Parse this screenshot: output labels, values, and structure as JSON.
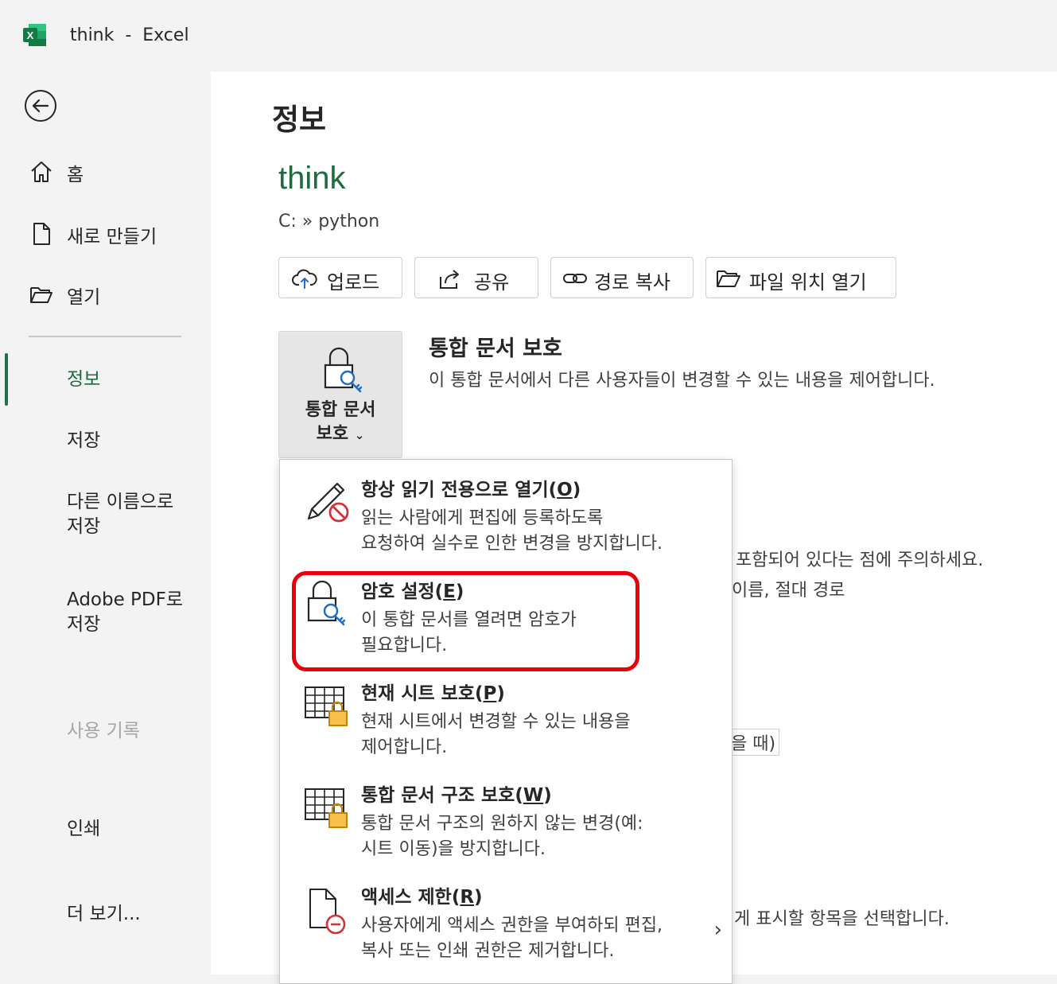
{
  "window": {
    "title": "think  -  Excel"
  },
  "sidebar": {
    "items": [
      {
        "label": "홈",
        "icon": "home-icon"
      },
      {
        "label": "새로 만들기",
        "icon": "new-file-icon"
      },
      {
        "label": "열기",
        "icon": "open-folder-icon"
      }
    ],
    "info": "정보",
    "save": "저장",
    "save_as": "다른 이름으로\n저장",
    "save_pdf": "Adobe PDF로\n저장",
    "history": "사용 기록",
    "print": "인쇄",
    "more": "더 보기..."
  },
  "main": {
    "page_title": "정보",
    "doc_name": "think",
    "doc_path": "C: » python",
    "actions": [
      {
        "label": "업로드",
        "icon": "upload-cloud-icon"
      },
      {
        "label": "공유",
        "icon": "share-icon"
      },
      {
        "label": "경로 복사",
        "icon": "link-icon"
      },
      {
        "label": "파일 위치 열기",
        "icon": "folder-open-icon"
      }
    ],
    "protect": {
      "tile_label_line1": "통합 문서",
      "tile_label_line2": "보호",
      "title": "통합 문서 보호",
      "description": "이 통합 문서에서 다른 사용자들이 변경할 수 있는 내용을 제어합니다."
    },
    "background_fragments": [
      "포함되어 있다는 점에 주의하세요.",
      "이름, 절대 경로",
      "을 때)",
      "게 표시할 항목을 선택합니다."
    ]
  },
  "protect_menu": {
    "items": [
      {
        "title": "항상 읽기 전용으로 열기",
        "key": "O",
        "desc": "읽는 사람에게 편집에 등록하도록\n요청하여 실수로 인한 변경을 방지합니다.",
        "icon": "pencil-prohibited-icon"
      },
      {
        "title": "암호 설정",
        "key": "E",
        "desc": "이 통합 문서를 열려면 암호가\n필요합니다.",
        "icon": "lock-key-icon"
      },
      {
        "title": "현재 시트 보호",
        "key": "P",
        "desc": "현재 시트에서 변경할 수 있는 내용을\n제어합니다.",
        "icon": "sheet-lock-icon"
      },
      {
        "title": "통합 문서 구조 보호",
        "key": "W",
        "desc": "통합 문서 구조의 원하지 않는 변경(예:\n시트 이동)을 방지합니다.",
        "icon": "workbook-lock-icon"
      },
      {
        "title": "액세스 제한",
        "key": "R",
        "desc": "사용자에게 액세스 권한을 부여하되 편집,\n복사 또는 인쇄 권한은 제거합니다.",
        "icon": "document-restrict-icon"
      }
    ]
  },
  "colors": {
    "excel_green": "#1e6b3e",
    "highlight_red": "#e8000a"
  }
}
